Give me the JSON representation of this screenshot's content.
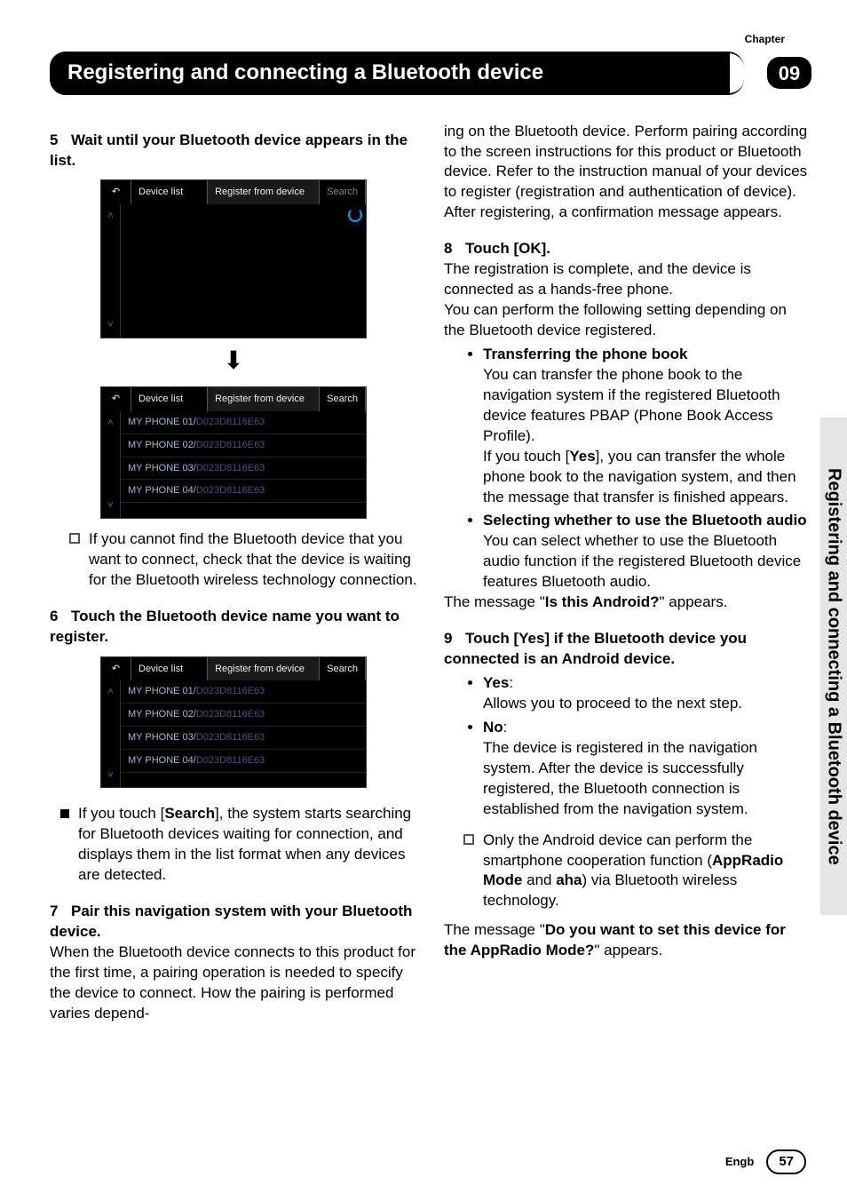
{
  "chapter_label": "Chapter",
  "chapter_number": "09",
  "title": "Registering and connecting a Bluetooth device",
  "side_tab": "Registering and connecting a Bluetooth device",
  "footer": {
    "lang": "Engb",
    "page": "57"
  },
  "left": {
    "step5": {
      "num": "5",
      "text": "Wait until your Bluetooth device appears in the list."
    },
    "note_after_shots": "If you cannot find the Bluetooth device that you want to connect, check that the device is waiting for the Bluetooth wireless technology connection.",
    "step6": {
      "num": "6",
      "text": "Touch the Bluetooth device name you want to register."
    },
    "search_note_pre": "If you touch [",
    "search_bold": "Search",
    "search_note_post": "], the system starts searching for Bluetooth devices waiting for connection, and displays them in the list format when any devices are detected.",
    "step7": {
      "num": "7",
      "text": "Pair this navigation system with your Bluetooth device."
    },
    "step7_body": "When the Bluetooth device connects to this product for the first time, a pairing operation is needed to specify the device to connect. How the pairing is performed varies depend-"
  },
  "right": {
    "cont7": "ing on the Bluetooth device. Perform pairing according to the  screen instructions for this product or Bluetooth device. Refer to the instruction manual of your devices to register (registration and  authentication of device). After registering, a confirmation message appears.",
    "step8": {
      "num": "8",
      "text": "Touch [OK]."
    },
    "step8_body1": "The registration is complete, and the device is connected as a hands-free phone.",
    "step8_body2": "You can perform the following setting depending on the Bluetooth device registered.",
    "sub8": [
      {
        "title": "Transferring the phone book",
        "body1": "You can transfer the phone book to the navigation system if the registered Bluetooth device features PBAP (Phone Book Access Profile).",
        "body2_pre": "If you touch [",
        "body2_bold": "Yes",
        "body2_post": "], you can transfer the whole phone book to the navigation system, and then the message that transfer is finished appears."
      },
      {
        "title": "Selecting whether to use the Bluetooth audio",
        "body1": "You can select whether to use the Bluetooth audio function if the registered Bluetooth device features Bluetooth audio."
      }
    ],
    "msg1_pre": "The message \"",
    "msg1_bold": "Is this Android?",
    "msg1_post": "\" appears.",
    "step9": {
      "num": "9",
      "text": "Touch [Yes] if the Bluetooth device you connected is an Android device."
    },
    "yesno": {
      "yes_label": "Yes",
      "yes_body": "Allows you to proceed to the next step.",
      "no_label": "No",
      "no_body": "The device is registered in the navigation system. After the device is successfully registered, the Bluetooth connection is established from the navigation system."
    },
    "android_note_pre": "Only the Android device can perform the smartphone cooperation function (",
    "android_note_b1": "AppRadio Mode",
    "android_note_mid": " and ",
    "android_note_b2": "aha",
    "android_note_post": ") via Bluetooth wireless technology.",
    "msg2_pre": "The message \"",
    "msg2_bold": "Do you want to set this device for the AppRadio Mode?",
    "msg2_post": "\" appears."
  },
  "shots": {
    "topbar": {
      "device_list": "Device list",
      "register": "Register from device",
      "search": "Search"
    },
    "rows": [
      {
        "name": "MY PHONE 01/",
        "mac": "D023D8116E63"
      },
      {
        "name": "MY PHONE 02/",
        "mac": "D023D8116E63"
      },
      {
        "name": "MY PHONE 03/",
        "mac": "D023D8116E63"
      },
      {
        "name": "MY PHONE 04/",
        "mac": "D023D8116E63"
      }
    ]
  }
}
